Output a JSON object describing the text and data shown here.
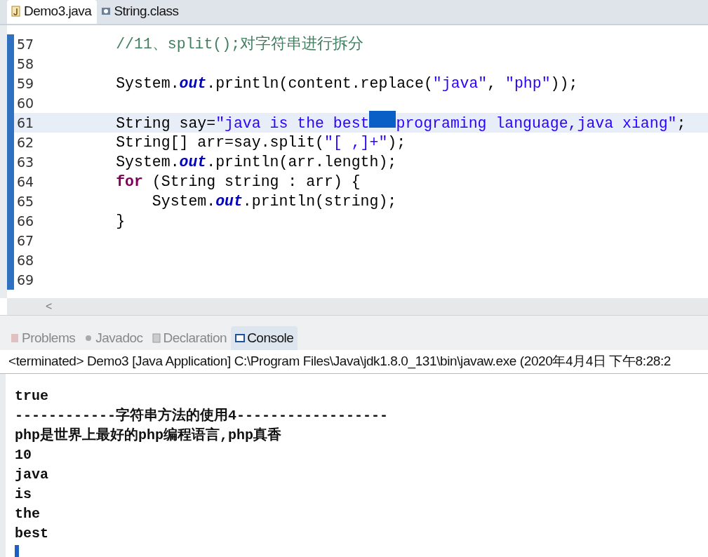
{
  "editor_tabs": [
    {
      "label": "Demo3.java",
      "selected": true
    },
    {
      "label": "String.class",
      "selected": false
    }
  ],
  "code_lines": [
    {
      "number": "57",
      "tokens": [
        {
          "text": "        //11、split();对字符串进行拆分",
          "kind": "comment"
        }
      ]
    },
    {
      "number": "58"
    },
    {
      "number": "59",
      "tokens": [
        {
          "text": "        System.",
          "kind": "plain"
        },
        {
          "text": "out",
          "kind": "field"
        },
        {
          "text": ".println(content.replace(",
          "kind": "plain"
        },
        {
          "text": "\"java\"",
          "kind": "string"
        },
        {
          "text": ", ",
          "kind": "plain"
        },
        {
          "text": "\"php\"",
          "kind": "string"
        },
        {
          "text": "));",
          "kind": "plain"
        }
      ]
    },
    {
      "number": "60"
    },
    {
      "number": "61",
      "current": true,
      "tokens": [
        {
          "text": "        String say=",
          "kind": "plain"
        },
        {
          "text": "\"java is the best",
          "kind": "string"
        },
        {
          "kind": "selection"
        },
        {
          "text": "programing language,java xiang\"",
          "kind": "string"
        },
        {
          "text": ";",
          "kind": "plain"
        }
      ]
    },
    {
      "number": "62",
      "tokens": [
        {
          "text": "        String[] arr=say.split(",
          "kind": "plain"
        },
        {
          "text": "\"[ ,]+\"",
          "kind": "string"
        },
        {
          "text": ");",
          "kind": "plain"
        }
      ]
    },
    {
      "number": "63",
      "tokens": [
        {
          "text": "        System.",
          "kind": "plain"
        },
        {
          "text": "out",
          "kind": "field"
        },
        {
          "text": ".println(arr.length);",
          "kind": "plain"
        }
      ]
    },
    {
      "number": "64",
      "tokens": [
        {
          "text": "        for",
          "kind": "keyword"
        },
        {
          "text": " (String string : arr) {",
          "kind": "plain"
        }
      ]
    },
    {
      "number": "65",
      "tokens": [
        {
          "text": "            System.",
          "kind": "plain"
        },
        {
          "text": "out",
          "kind": "field"
        },
        {
          "text": ".println(string);",
          "kind": "plain"
        }
      ]
    },
    {
      "number": "66",
      "tokens": [
        {
          "text": "        }",
          "kind": "plain"
        }
      ]
    },
    {
      "number": "67"
    },
    {
      "number": "68"
    },
    {
      "number": "69"
    }
  ],
  "scroll_left": "<",
  "view_tabs": [
    {
      "label": "Problems",
      "selected": false
    },
    {
      "label": "Javadoc",
      "selected": false
    },
    {
      "label": "Declaration",
      "selected": false
    },
    {
      "label": "Console",
      "selected": true
    }
  ],
  "console_header": "<terminated> Demo3 [Java Application] C:\\Program Files\\Java\\jdk1.8.0_131\\bin\\javaw.exe (2020年4月4日 下午8:28:2",
  "console_lines": [
    "true",
    "------------字符串方法的使用4------------------",
    "php是世界上最好的php编程语言,php真香",
    "10",
    "java",
    "is",
    "the",
    "best"
  ]
}
